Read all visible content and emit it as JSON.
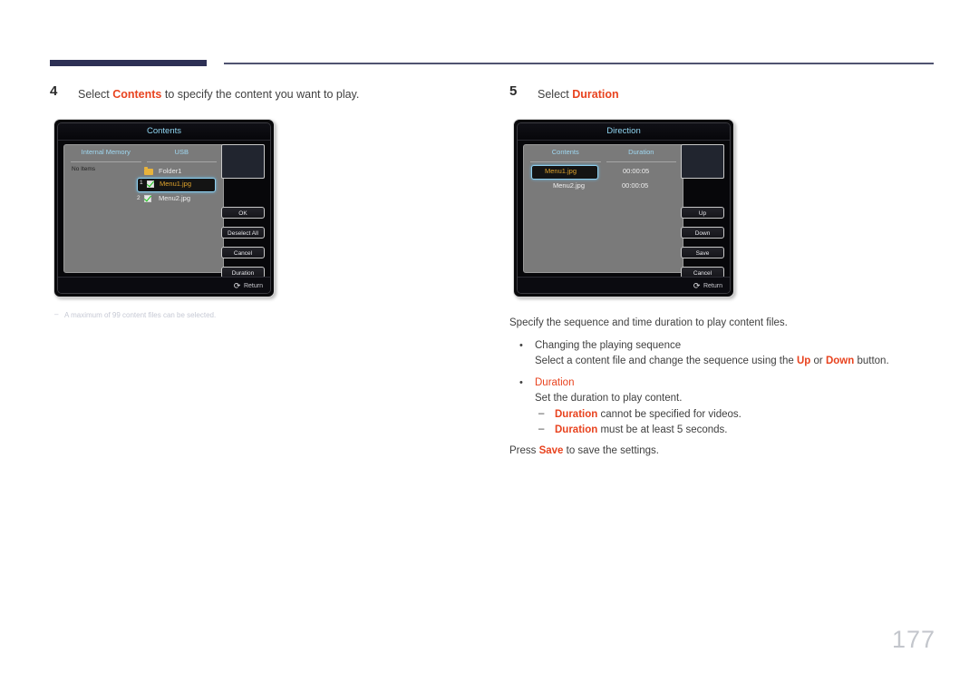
{
  "page": {
    "number": "177"
  },
  "left": {
    "step": {
      "num": "4",
      "before": "Select ",
      "highlight": "Contents",
      "after": " to specify the content you want to play."
    },
    "dialog": {
      "title": "Contents",
      "columns": [
        "Internal Memory",
        "USB"
      ],
      "internal_memory_empty_label": "No Items",
      "files": [
        {
          "index": "",
          "name": "Folder1",
          "type": "folder",
          "selected": false,
          "checked": false
        },
        {
          "index": "1",
          "name": "Menu1.jpg",
          "type": "file",
          "selected": true,
          "checked": true
        },
        {
          "index": "2",
          "name": "Menu2.jpg",
          "type": "file",
          "selected": false,
          "checked": true
        }
      ],
      "buttons": [
        "OK",
        "Deselect All",
        "Cancel",
        "Duration"
      ],
      "footer": "Return"
    },
    "note": {
      "dash": "–",
      "text": "A maximum of 99 content files can be selected."
    }
  },
  "right": {
    "step": {
      "num": "5",
      "before": "Select ",
      "highlight": "Duration",
      "after": ""
    },
    "dialog": {
      "title": "Direction",
      "columns": [
        "Contents",
        "Duration"
      ],
      "rows": [
        {
          "name": "Menu1.jpg",
          "duration": "00:00:05",
          "selected": true
        },
        {
          "name": "Menu2.jpg",
          "duration": "00:00:05",
          "selected": false
        }
      ],
      "buttons": [
        "Up",
        "Down",
        "Save",
        "Cancel"
      ],
      "footer": "Return"
    },
    "intro": "Specify the sequence and time duration to play content files.",
    "bullets": [
      {
        "dot": "•",
        "line1": "Changing the playing sequence",
        "line2_a": "Select a content file and change the sequence using the ",
        "line2_hl1": "Up",
        "line2_b": " or ",
        "line2_hl2": "Down",
        "line2_c": " button."
      },
      {
        "dot": "•",
        "title_hl": "Duration",
        "line1": "Set the duration to play content.",
        "subs": [
          {
            "dash": "–",
            "hl": "Duration",
            "text": " cannot be specified for videos."
          },
          {
            "dash": "–",
            "hl": "Duration",
            "text": " must be at least 5 seconds."
          }
        ]
      }
    ],
    "press": {
      "before": "Press ",
      "highlight": "Save",
      "after": " to save the settings."
    }
  }
}
